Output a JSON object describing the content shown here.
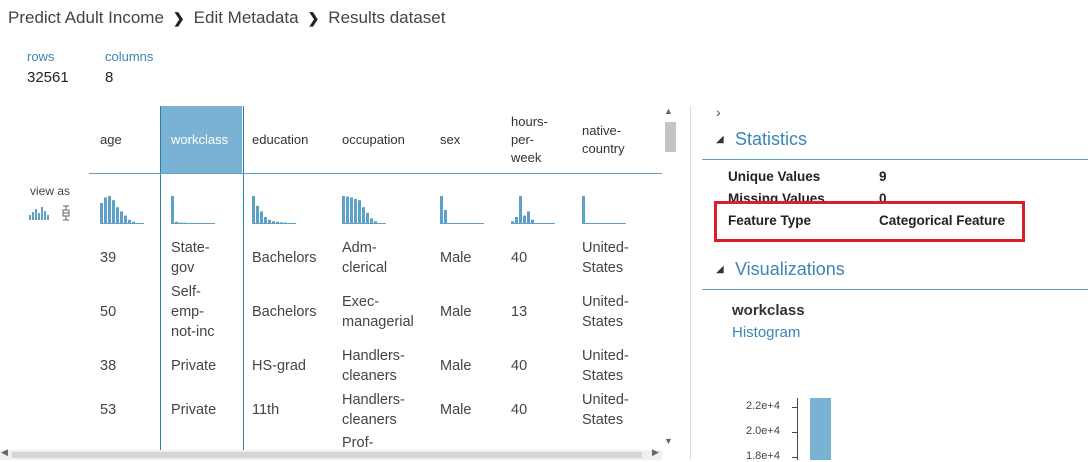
{
  "breadcrumb": [
    "Predict Adult Income",
    "Edit Metadata",
    "Results dataset"
  ],
  "summary": {
    "rows_label": "rows",
    "rows_value": "32561",
    "columns_label": "columns",
    "columns_value": "8"
  },
  "view_as_label": "view as",
  "table": {
    "columns": [
      "age",
      "workclass",
      "education",
      "occupation",
      "sex",
      "hours-per-week",
      "native-country"
    ],
    "selected_column": "workclass",
    "header_lines": [
      [
        "age"
      ],
      [
        "workclass"
      ],
      [
        "education"
      ],
      [
        "occupation"
      ],
      [
        "sex"
      ],
      [
        "hours-",
        "per-",
        "week"
      ],
      [
        "native-",
        "country"
      ]
    ],
    "rows": [
      [
        [
          "39"
        ],
        [
          "State-",
          "gov"
        ],
        [
          "Bachelors"
        ],
        [
          "Adm-",
          "clerical"
        ],
        [
          "Male"
        ],
        [
          "40"
        ],
        [
          "United-",
          "States"
        ]
      ],
      [
        [
          "50"
        ],
        [
          "Self-",
          "emp-",
          "not-inc"
        ],
        [
          "Bachelors"
        ],
        [
          "Exec-",
          "managerial"
        ],
        [
          "Male"
        ],
        [
          "13"
        ],
        [
          "United-",
          "States"
        ]
      ],
      [
        [
          "38"
        ],
        [
          "Private"
        ],
        [
          "HS-grad"
        ],
        [
          "Handlers-",
          "cleaners"
        ],
        [
          "Male"
        ],
        [
          "40"
        ],
        [
          "United-",
          "States"
        ]
      ],
      [
        [
          "53"
        ],
        [
          "Private"
        ],
        [
          "11th"
        ],
        [
          "Handlers-",
          "cleaners"
        ],
        [
          "Male"
        ],
        [
          "40"
        ],
        [
          "United-",
          "States"
        ]
      ],
      [
        [
          ""
        ],
        [
          ""
        ],
        [
          ""
        ],
        [
          "Prof-"
        ],
        [
          ""
        ],
        [
          ""
        ],
        [
          ""
        ]
      ]
    ],
    "sparklines": [
      [
        0.75,
        0.95,
        1.0,
        0.85,
        0.6,
        0.45,
        0.3,
        0.15,
        0.08
      ],
      [
        1.0,
        0.08,
        0.05,
        0.05,
        0.04,
        0.04,
        0.03
      ],
      [
        1.0,
        0.65,
        0.45,
        0.25,
        0.15,
        0.1,
        0.08,
        0.06,
        0.05,
        0.04
      ],
      [
        1.0,
        0.98,
        0.95,
        0.9,
        0.85,
        0.6,
        0.4,
        0.2,
        0.1
      ],
      [
        1.0,
        0.5
      ],
      [
        0.1,
        0.25,
        1.0,
        0.3,
        0.45,
        0.15
      ],
      [
        1.0,
        0.04
      ]
    ]
  },
  "statistics": {
    "title": "Statistics",
    "items": [
      {
        "key": "Unique Values",
        "value": "9"
      },
      {
        "key": "Missing Values",
        "value": "0"
      },
      {
        "key": "Feature Type",
        "value": "Categorical Feature"
      }
    ]
  },
  "visualizations": {
    "title": "Visualizations",
    "column": "workclass",
    "type": "Histogram",
    "y_ticks": [
      "2.2e+4",
      "2.0e+4",
      "1.8e+4"
    ],
    "bar_value": 22696
  },
  "colors": {
    "accent": "#3a86b4",
    "selected_header": "#79b2d2",
    "highlight": "#d9202a"
  }
}
